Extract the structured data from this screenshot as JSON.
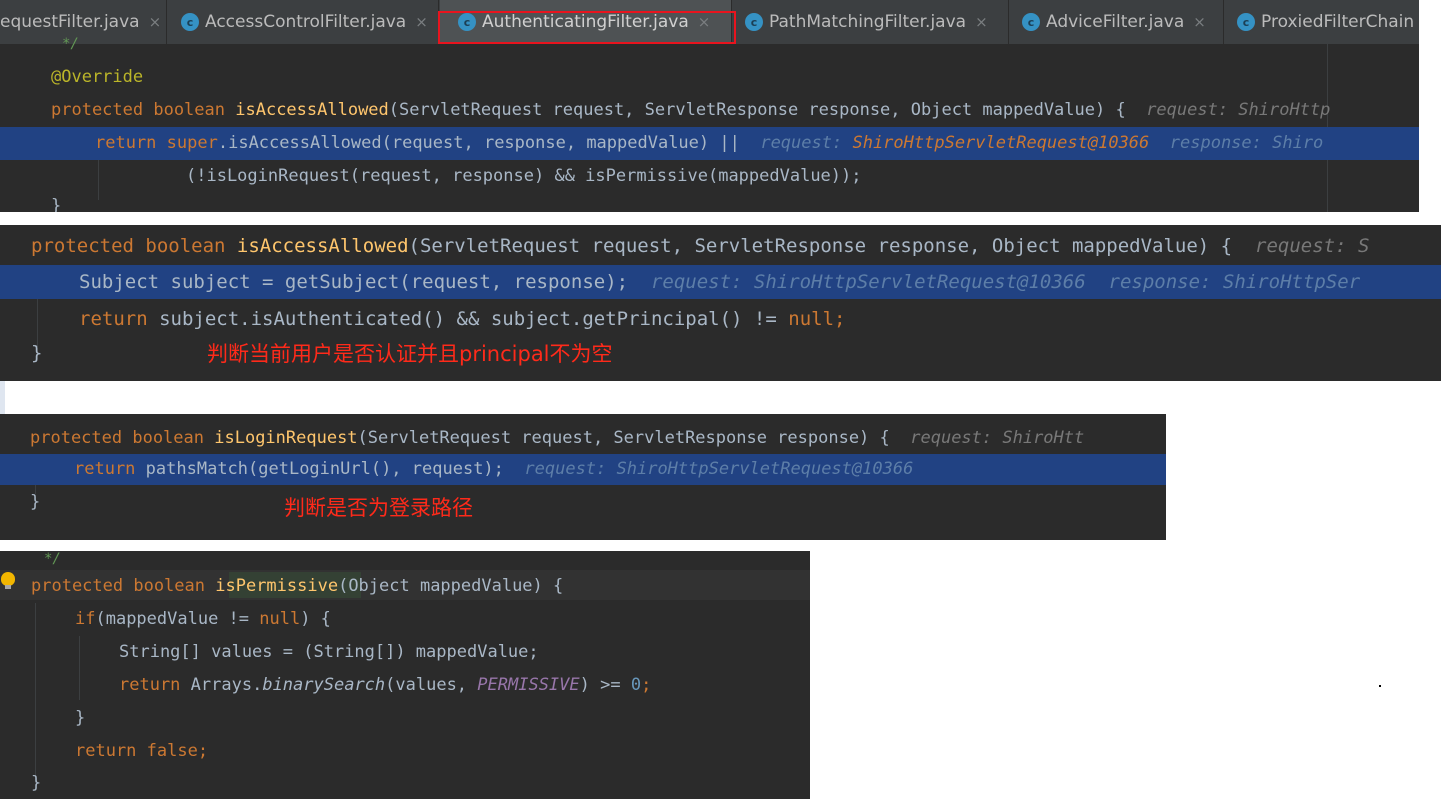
{
  "tabs": [
    {
      "label": "equestFilter.java",
      "icon": "class-c-icon"
    },
    {
      "label": "AccessControlFilter.java",
      "icon": "class-c-icon"
    },
    {
      "label": "AuthenticatingFilter.java",
      "icon": "class-c-icon",
      "active": true
    },
    {
      "label": "PathMatchingFilter.java",
      "icon": "class-c-icon"
    },
    {
      "label": "AdviceFilter.java",
      "icon": "class-c-icon"
    },
    {
      "label": "ProxiedFilterChain",
      "icon": "class-c-icon"
    }
  ],
  "tab_close_glyph": "×",
  "tab_icon_letter": "c",
  "code1": {
    "comment_tail": "*/",
    "annotation": "@Override",
    "sig": {
      "mod": "protected boolean",
      "name": "isAccessAllowed",
      "params": "(ServletRequest request, ServletResponse response, Object mappedValue) {",
      "hint": "request: ShiroHttp"
    },
    "ret": {
      "kw_return": "return",
      "kw_super": "super",
      "call": ".isAccessAllowed(request, response, mappedValue) ||",
      "hint_req_label": "request:",
      "hint_req_value": "ShiroHttpServletRequest@10366",
      "hint_resp": "response: Shiro"
    },
    "cont": "(!isLoginRequest(request, response) && isPermissive(mappedValue));",
    "close": "}"
  },
  "code2": {
    "sig": {
      "mod": "protected boolean",
      "name": "isAccessAllowed",
      "params": "(ServletRequest request, ServletResponse response, Object mappedValue) {",
      "hint": "request: S"
    },
    "line1": {
      "code": "Subject subject = getSubject(request, response);",
      "hint": "request: ShiroHttpServletRequest@10366  response: ShiroHttpSer"
    },
    "line2": {
      "kw_return": "return",
      "code": "subject.isAuthenticated() && subject.getPrincipal() != ",
      "kw_null": "null",
      "semi": ";"
    },
    "close": "}",
    "note": "判断当前用户是否认证并且principal不为空"
  },
  "code3": {
    "sig": {
      "mod": "protected boolean",
      "name": "isLoginRequest",
      "params": "(ServletRequest request, ServletResponse response) {",
      "hint": "request: ShiroHtt"
    },
    "line1": {
      "kw_return": "return",
      "code": "pathsMatch(getLoginUrl(), request);",
      "hint": "request: ShiroHttpServletRequest@10366"
    },
    "close": "}",
    "note": "判断是否为登录路径"
  },
  "code4": {
    "comment_tail": "*/",
    "sig": {
      "mod": "protected boolean",
      "name": "isPermissive",
      "params": "(Object mappedValue) {"
    },
    "if_line": {
      "kw_if": "if",
      "code": "(mappedValue != ",
      "kw_null": "null",
      "end": ") {"
    },
    "decl": "String[] values = (String[]) mappedValue;",
    "ret_search": {
      "kw_return": "return",
      "code": "Arrays.",
      "method": "binarySearch",
      "args": "(values, ",
      "const": "PERMISSIVE",
      "end": ") >= ",
      "num": "0",
      "semi": ";"
    },
    "close_if": "}",
    "ret_false": {
      "kw_return": "return",
      "kw_false": "false",
      "semi": ";"
    },
    "close": "}"
  }
}
